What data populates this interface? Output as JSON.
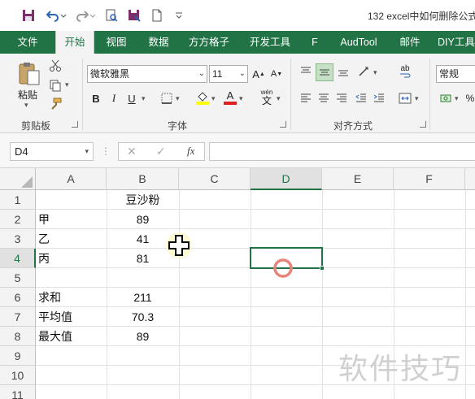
{
  "title": "132 excel中如何删除公式",
  "qat": {
    "icons": [
      "save-icon",
      "undo-icon",
      "redo-icon",
      "print-preview-icon",
      "save-as-icon",
      "new-document-icon",
      "customize-icon"
    ]
  },
  "tabs": [
    {
      "label": "文件",
      "active": false
    },
    {
      "label": "开始",
      "active": true
    },
    {
      "label": "视图",
      "active": false
    },
    {
      "label": "数据",
      "active": false
    },
    {
      "label": "方方格子",
      "active": false
    },
    {
      "label": "开发工具",
      "active": false
    },
    {
      "label": "F",
      "active": false
    },
    {
      "label": "AudTool",
      "active": false
    },
    {
      "label": "邮件",
      "active": false
    },
    {
      "label": "DIY工具",
      "active": false
    }
  ],
  "ribbon": {
    "clipboard": {
      "paste_label": "粘贴",
      "group_label": "剪贴板"
    },
    "font": {
      "family": "微软雅黑",
      "size": "11",
      "bold": "B",
      "italic": "I",
      "underline": "U",
      "group_label": "字体",
      "wen": "wén",
      "wen_char": "文",
      "grow": "A",
      "shrink": "A"
    },
    "alignment": {
      "group_label": "对齐方式",
      "ab": "ab"
    },
    "number": {
      "format": "常规"
    }
  },
  "formula_bar": {
    "name_box": "D4",
    "fx": "fx",
    "formula": ""
  },
  "grid": {
    "columns": [
      "A",
      "B",
      "C",
      "D",
      "E",
      "F"
    ],
    "selected_column": "D",
    "rows": [
      "1",
      "2",
      "3",
      "4",
      "5",
      "6",
      "7",
      "8",
      "9",
      "10",
      "11"
    ],
    "selected_row": "4",
    "cells": {
      "B1": "豆沙粉",
      "A2": "甲",
      "B2": "89",
      "A3": "乙",
      "B3": "41",
      "A4": "丙",
      "B4": "81",
      "A6": "求和",
      "B6": "211",
      "A7": "平均值",
      "B7": "70.3",
      "A8": "最大值",
      "B8": "89"
    },
    "active_cell": "D4"
  },
  "watermark": "软件技巧"
}
